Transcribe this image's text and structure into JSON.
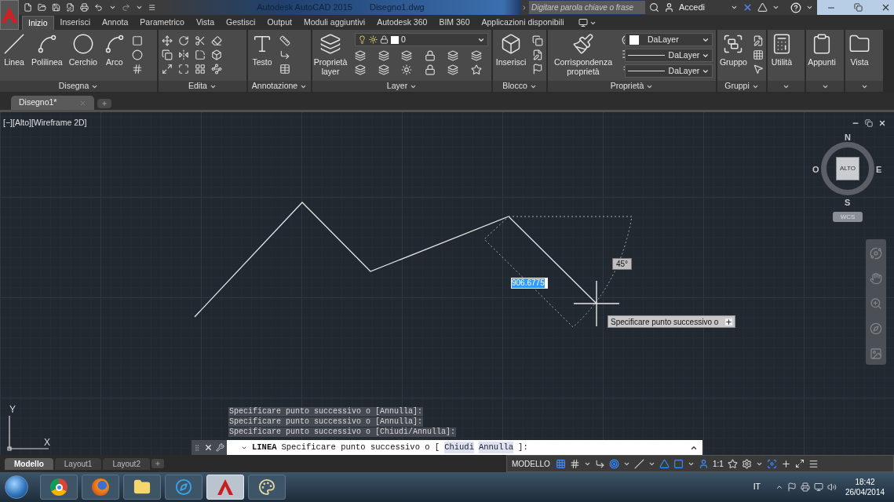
{
  "title_bar": {
    "title": "Autodesk AutoCAD 2015",
    "file": "Disegno1.dwg",
    "search": {
      "placeholder": "Digitare parola chiave o frase"
    },
    "sign_in": "Accedi"
  },
  "ribbon_tabs": [
    {
      "label": "Inizio",
      "selected": true
    },
    {
      "label": "Inserisci",
      "selected": false
    },
    {
      "label": "Annota",
      "selected": false
    },
    {
      "label": "Parametrico",
      "selected": false
    },
    {
      "label": "Vista",
      "selected": false
    },
    {
      "label": "Gestisci",
      "selected": false
    },
    {
      "label": "Output",
      "selected": false
    },
    {
      "label": "Moduli aggiuntivi",
      "selected": false
    },
    {
      "label": "Autodesk 360",
      "selected": false
    },
    {
      "label": "BIM 360",
      "selected": false
    },
    {
      "label": "Applicazioni disponibili",
      "selected": false
    }
  ],
  "ribbon_panels": [
    {
      "title": "Disegna",
      "tools": [
        {
          "label": "Linea"
        },
        {
          "label": "Polilinea"
        },
        {
          "label": "Cerchio"
        },
        {
          "label": "Arco"
        }
      ]
    },
    {
      "title": "Edita"
    },
    {
      "title": "Annotazione",
      "tools": [
        {
          "label": "Testo"
        }
      ]
    },
    {
      "title": "Layer",
      "tools": [
        {
          "label": "Proprietà layer"
        }
      ],
      "dropdowns": [
        {
          "kind": "layer",
          "value": "0"
        }
      ]
    },
    {
      "title": "Blocco",
      "tools": [
        {
          "label": "Inserisci"
        }
      ]
    },
    {
      "title": "Proprietà",
      "tools": [
        {
          "label": "Corrispondenza proprietà"
        }
      ],
      "dropdowns": [
        {
          "kind": "color",
          "value": "DaLayer"
        },
        {
          "kind": "line",
          "value": "DaLayer"
        },
        {
          "kind": "line",
          "value": "DaLayer"
        }
      ]
    },
    {
      "title": "Gruppi",
      "tools": [
        {
          "label": "Gruppo"
        }
      ]
    },
    {
      "tools": [
        {
          "label": "Utilità"
        }
      ]
    },
    {
      "tools": [
        {
          "label": "Appunti"
        }
      ]
    },
    {
      "tools": [
        {
          "label": "Vista"
        }
      ]
    }
  ],
  "document_tabs": [
    {
      "label": "Disegno1*",
      "selected": true
    }
  ],
  "viewport_label": "[−][Alto][Wireframe 2D]",
  "viewcube": {
    "north": "N",
    "south": "S",
    "east": "E",
    "west": "O",
    "face": "ALTO",
    "ucs": "WCS"
  },
  "dynamic_input": {
    "distance": "906.6775",
    "angle": "45°",
    "prompt": "Specificare punto successivo o"
  },
  "ucs_icon": {
    "x": "X",
    "y": "Y"
  },
  "command_history": [
    "Specificare punto successivo o [Annulla]:",
    "Specificare punto successivo o [Annulla]:",
    "Specificare punto successivo o [Chiudi/Annulla]:"
  ],
  "command_line": {
    "command": "LINEA",
    "prompt": "Specificare punto successivo o [",
    "options": [
      "Chiudi",
      "Annulla"
    ],
    "end": "]:"
  },
  "layout_tabs": [
    {
      "label": "Modello",
      "selected": true
    },
    {
      "label": "Layout1",
      "selected": false
    },
    {
      "label": "Layout2",
      "selected": false
    }
  ],
  "status_bar": {
    "space": "MODELLO",
    "scale": "1:1",
    "toggles": [
      {
        "on": true
      },
      {
        "on": false
      },
      {
        "on": false
      },
      {
        "on": true
      },
      {
        "on": false
      },
      {
        "on": true
      },
      {
        "on": true
      },
      {
        "on": true
      },
      {
        "on": false
      },
      {
        "on": false
      },
      {
        "on": true
      }
    ]
  },
  "taskbar": {
    "language": "IT",
    "time": "18:42",
    "date": "26/04/2014"
  }
}
